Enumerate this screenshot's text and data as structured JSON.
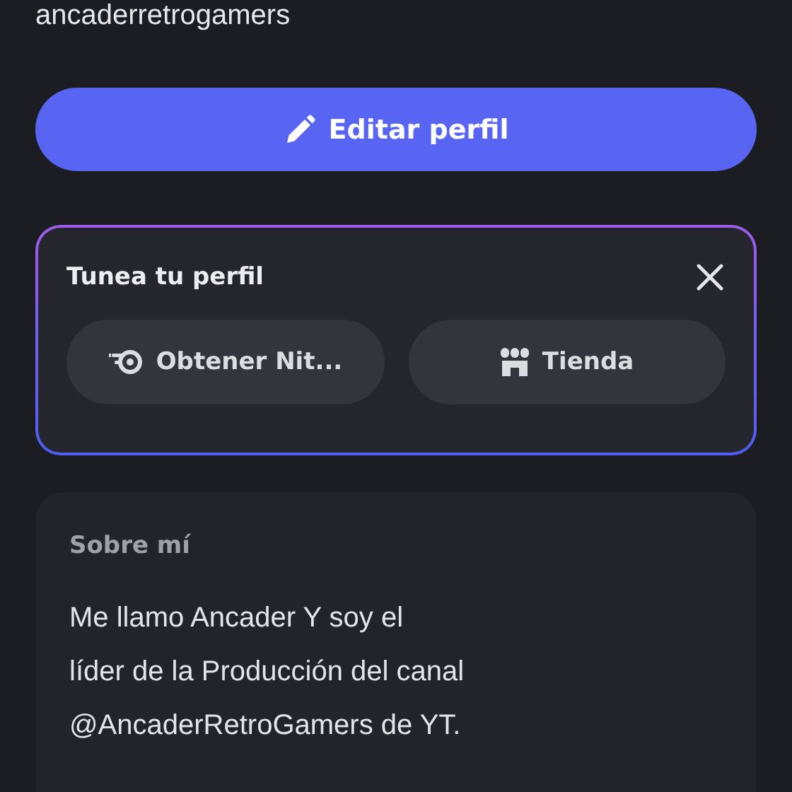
{
  "username": "ancaderretrogamers",
  "edit_button": {
    "label": "Editar perfil"
  },
  "customize_card": {
    "title": "Tunea tu perfil",
    "closable": true,
    "actions": [
      {
        "kind": "nitro",
        "label": "Obtener Nit..."
      },
      {
        "kind": "shop",
        "label": "Tienda"
      }
    ]
  },
  "about": {
    "heading": "Sobre mí",
    "text": "Me llamo Ancader Y soy el\nlíder de la Producción del canal\n@AncaderRetroGamers de YT."
  }
}
